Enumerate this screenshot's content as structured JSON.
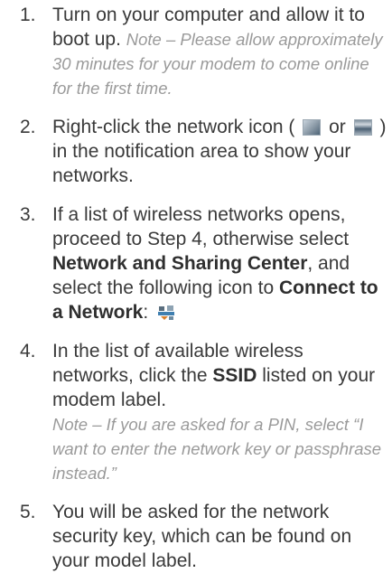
{
  "steps": [
    {
      "number": "1.",
      "text": "Turn on your computer and allow it to boot up.",
      "note": "Note – Please allow approximately 30 minutes for your modem to come online for the first time."
    },
    {
      "number": "2.",
      "text_before_icons": "Right-click the network icon (",
      "or_text": " or ",
      "text_after_icons": ") in the notification area to show your networks.",
      "icons": [
        "wired-network-icon",
        "wireless-network-icon"
      ]
    },
    {
      "number": "3.",
      "text_intro": "If a list of wireless networks opens, proceed to Step 4, otherwise select ",
      "bold_nsc": "Network and Sharing Center",
      "text_middle": ", and select the following icon to ",
      "bold_connect": "Connect to a Network",
      "text_colon": ":",
      "icon": "connect-to-network-icon"
    },
    {
      "number": "4.",
      "text_before_bold": "In the list of available wireless networks, click the ",
      "bold_ssid": "SSID",
      "text_after_bold": " listed on your modem label.",
      "note": "Note – If you are asked for a PIN, select “I want to enter the network key or passphrase instead.”"
    },
    {
      "number": "5.",
      "text": "You will be asked for the network security key, which can be found on your model label."
    }
  ]
}
